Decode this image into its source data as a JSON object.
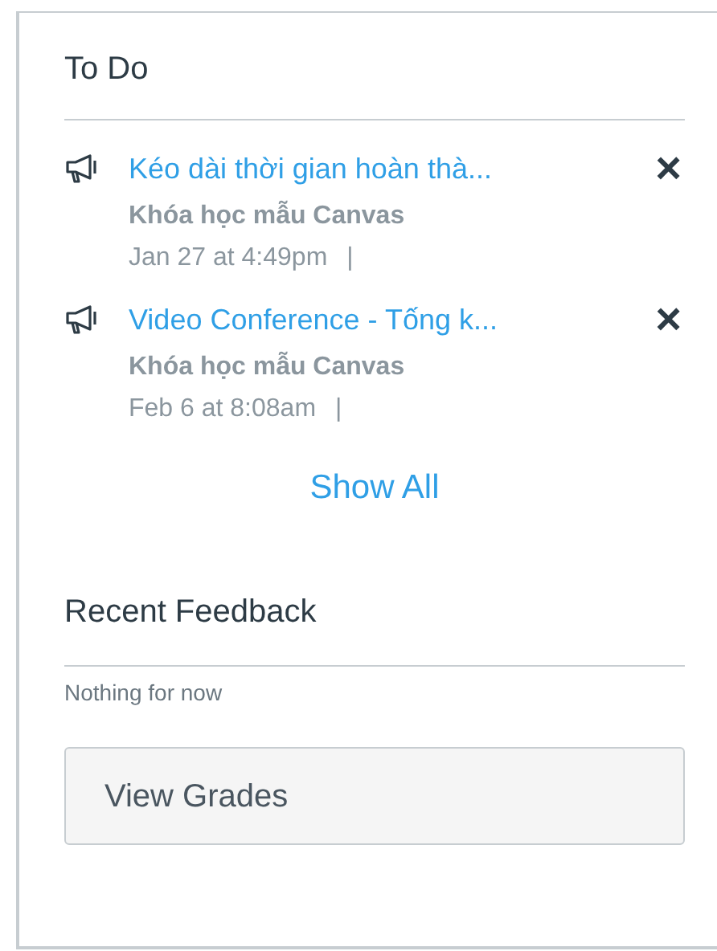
{
  "todo": {
    "title": "To Do",
    "items": [
      {
        "title": "Kéo dài thời gian hoàn thà...",
        "course": "Khóa học mẫu Canvas",
        "date": "Jan 27 at 4:49pm",
        "separator": "|",
        "dismiss": "×"
      },
      {
        "title": "Video Conference - Tống k...",
        "course": "Khóa học mẫu Canvas",
        "date": "Feb 6 at 8:08am",
        "separator": "|",
        "dismiss": "×"
      }
    ],
    "show_all": "Show All"
  },
  "feedback": {
    "title": "Recent Feedback",
    "empty_text": "Nothing for now",
    "button": "View Grades"
  }
}
